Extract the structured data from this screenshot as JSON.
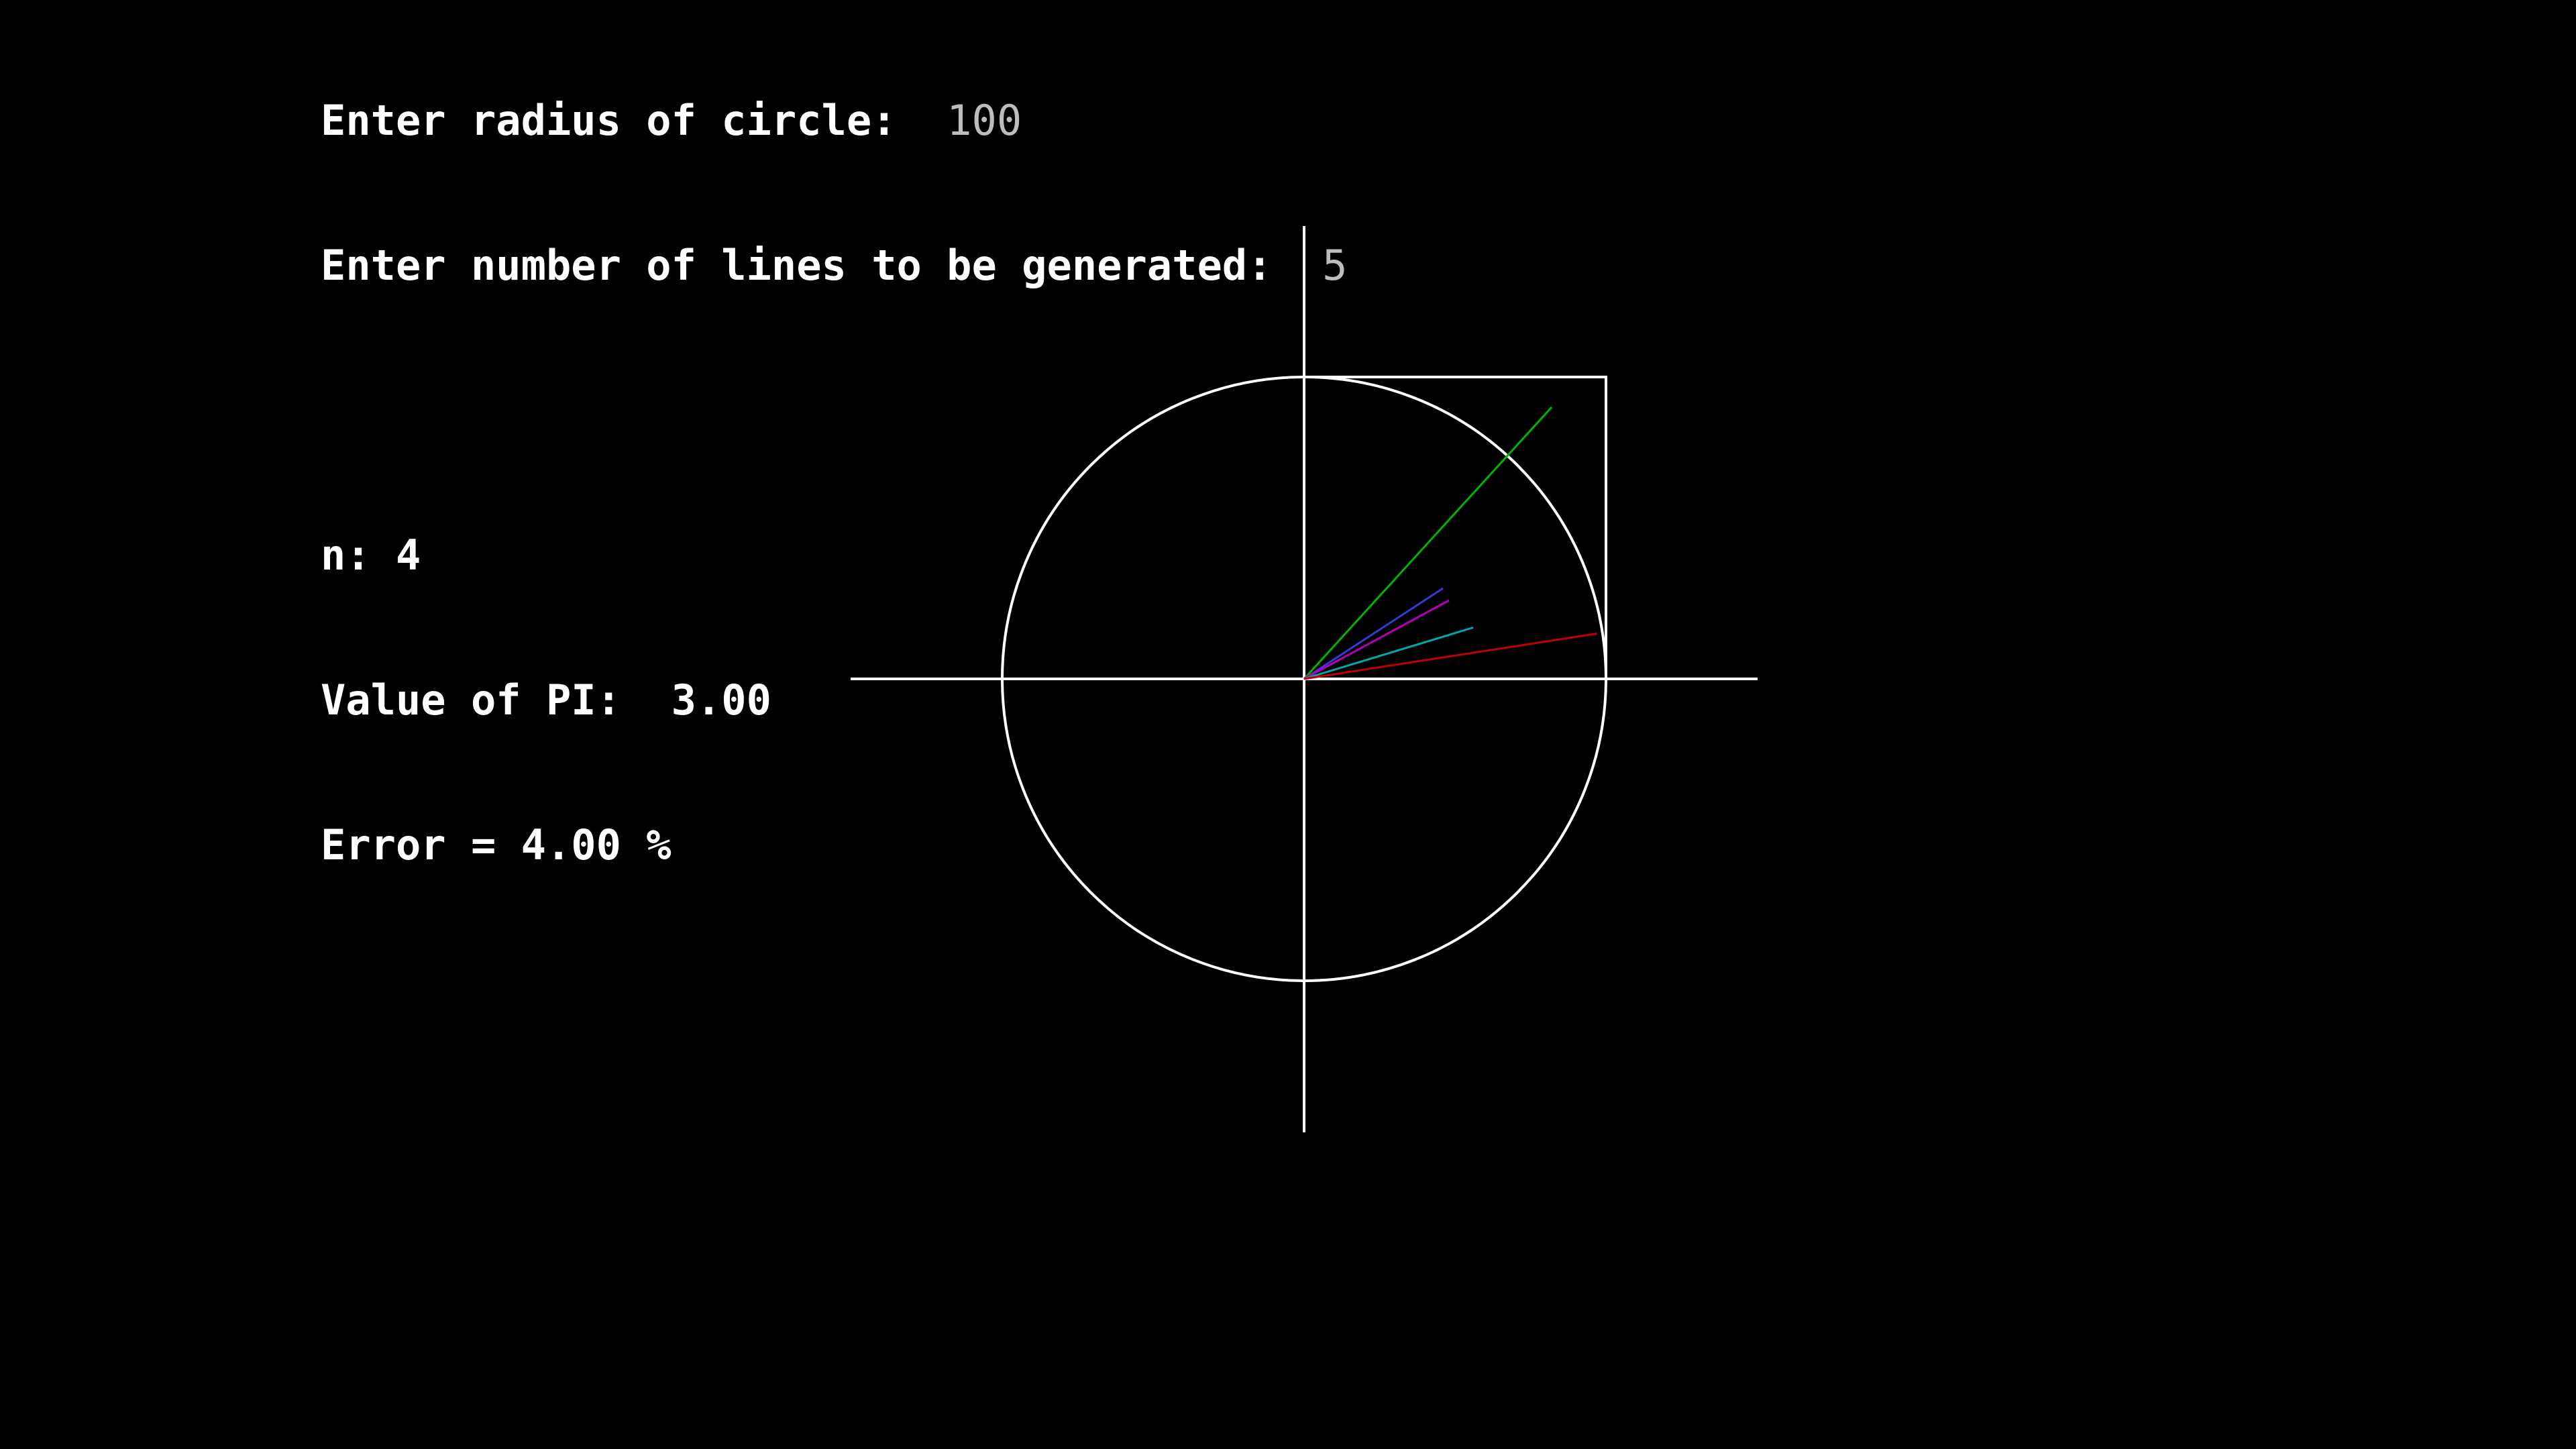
{
  "console": {
    "radius_prompt": "Enter radius of circle: ",
    "radius_value": "100",
    "lines_prompt": "Enter number of lines to be generated: ",
    "lines_value": "5",
    "n_label": "n:",
    "n_value": "4",
    "pi_label": "Value of PI: ",
    "pi_value": "3.00",
    "error_label": "Error =",
    "error_value": "4.00",
    "error_unit": "%"
  },
  "colors": {
    "background": "#000000",
    "text": "#FFFFFF",
    "input_value": "#BDBDBD",
    "axes": "#FFFFFF",
    "circle": "#FFFFFF",
    "square": "#FFFFFF"
  },
  "chart_data": {
    "type": "scatter",
    "radius": 100,
    "axis_range": [
      -150,
      150
    ],
    "circle": {
      "center": [
        0,
        0
      ],
      "radius": 100
    },
    "square_quadrant": {
      "x": [
        0,
        100
      ],
      "y": [
        0,
        100
      ]
    },
    "lines": [
      {
        "x": 82,
        "y": 90,
        "color": "#00B400"
      },
      {
        "x": 46,
        "y": 30,
        "color": "#3838D8"
      },
      {
        "x": 48,
        "y": 26,
        "color": "#B400B4"
      },
      {
        "x": 56,
        "y": 17,
        "color": "#00A8A8"
      },
      {
        "x": 97,
        "y": 15,
        "color": "#C00000"
      }
    ]
  }
}
